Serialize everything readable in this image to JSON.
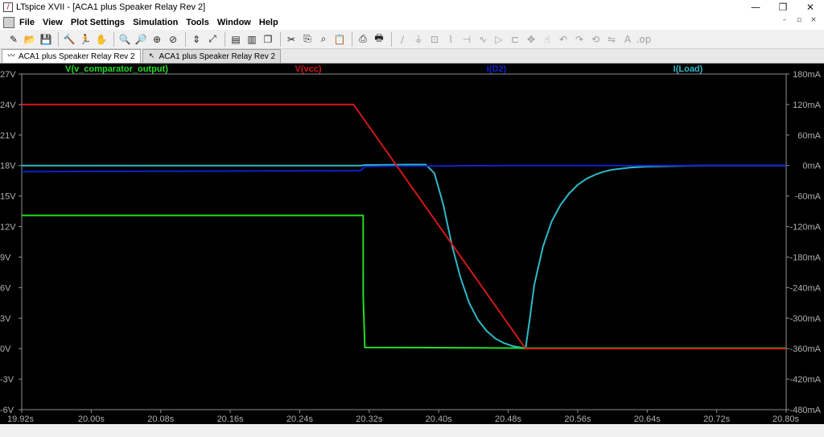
{
  "window": {
    "title": "LTspice XVII - [ACA1 plus Speaker Relay Rev 2]",
    "controls": [
      "—",
      "❐",
      "✕"
    ]
  },
  "menu": {
    "items": [
      "File",
      "View",
      "Plot Settings",
      "Simulation",
      "Tools",
      "Window",
      "Help"
    ],
    "mdi_controls": [
      "–",
      "▫",
      "×"
    ]
  },
  "tabs": [
    {
      "label": "ACA1 plus Speaker Relay Rev 2",
      "icon": "waveform-icon",
      "active": true
    },
    {
      "label": "ACA1 plus Speaker Relay Rev 2",
      "icon": "schematic-icon",
      "active": false
    }
  ],
  "toolbar_icons": [
    "new-schematic-icon",
    "open-icon",
    "save-icon",
    "sep",
    "control-panel-icon",
    "run-icon",
    "halt-icon",
    "sep",
    "zoom-in-icon",
    "zoom-out-icon",
    "zoom-area-icon",
    "zoom-cancel-icon",
    "sep",
    "autorange-icon",
    "zoom-fit-icon",
    "sep",
    "tile-horizontal-icon",
    "tile-vertical-icon",
    "cascade-icon",
    "sep",
    "cut-icon",
    "copy-icon",
    "find-icon",
    "paste-icon",
    "sep",
    "print-icon",
    "print-setup-icon",
    "sep",
    "wire-icon",
    "ground-icon",
    "label-icon",
    "resistor-icon",
    "capacitor-icon",
    "inductor-icon",
    "diode-icon",
    "component-icon",
    "move-icon",
    "drag-icon",
    "undo-icon",
    "redo-icon",
    "rotate-icon",
    "mirror-icon",
    "text-icon",
    "spice-directive-icon"
  ],
  "chart_data": {
    "type": "line",
    "xlabel": "",
    "x_ticks": [
      "19.92s",
      "20.00s",
      "20.08s",
      "20.16s",
      "20.24s",
      "20.32s",
      "20.40s",
      "20.48s",
      "20.56s",
      "20.64s",
      "20.72s",
      "20.80s"
    ],
    "xlim": [
      19.92,
      20.8
    ],
    "left_axis": {
      "ticks": [
        "27V",
        "24V",
        "21V",
        "18V",
        "15V",
        "12V",
        "9V",
        "6V",
        "3V",
        "0V",
        "-3V",
        "-6V"
      ],
      "ylim": [
        -6,
        27
      ]
    },
    "right_axis": {
      "ticks": [
        "180mA",
        "120mA",
        "60mA",
        "0mA",
        "-60mA",
        "-120mA",
        "-180mA",
        "-240mA",
        "-300mA",
        "-360mA",
        "-420mA",
        "-480mA"
      ],
      "ylim": [
        -480,
        180
      ]
    },
    "grid": false,
    "series": [
      {
        "name": "V(v_comparator_output)",
        "color": "#22dd22",
        "axis": "left",
        "x": [
          19.92,
          20.313,
          20.3131,
          20.315,
          20.45,
          20.5,
          20.8
        ],
        "y": [
          13.1,
          13.1,
          5.0,
          0.12,
          0.08,
          0.05,
          0.05
        ]
      },
      {
        "name": "V(vcc)",
        "color": "#d01818",
        "axis": "left",
        "x": [
          19.92,
          20.302,
          20.5,
          20.8
        ],
        "y": [
          24.0,
          24.0,
          0.0,
          0.0
        ]
      },
      {
        "name": "I(D2)",
        "color": "#1020c8",
        "axis": "right",
        "x": [
          19.92,
          20.31,
          20.315,
          20.35,
          20.5,
          20.8
        ],
        "y": [
          -12,
          -10,
          -2,
          -1,
          0,
          0
        ]
      },
      {
        "name": "I(Load)",
        "color": "#30b8c8",
        "axis": "right",
        "x": [
          19.92,
          20.31,
          20.315,
          20.37,
          20.385,
          20.395,
          20.405,
          20.415,
          20.425,
          20.435,
          20.445,
          20.455,
          20.465,
          20.475,
          20.485,
          20.495,
          20.5,
          20.505,
          20.51,
          20.52,
          20.53,
          20.54,
          20.55,
          20.56,
          20.57,
          20.58,
          20.59,
          20.6,
          20.62,
          20.64,
          20.7,
          20.8
        ],
        "y": [
          0,
          0,
          1,
          2,
          2,
          -15,
          -75,
          -155,
          -220,
          -270,
          -303,
          -325,
          -340,
          -349,
          -355,
          -358,
          -360,
          -300,
          -235,
          -160,
          -110,
          -78,
          -55,
          -38,
          -26,
          -18,
          -12,
          -8,
          -4,
          -2,
          0,
          0
        ]
      }
    ]
  }
}
